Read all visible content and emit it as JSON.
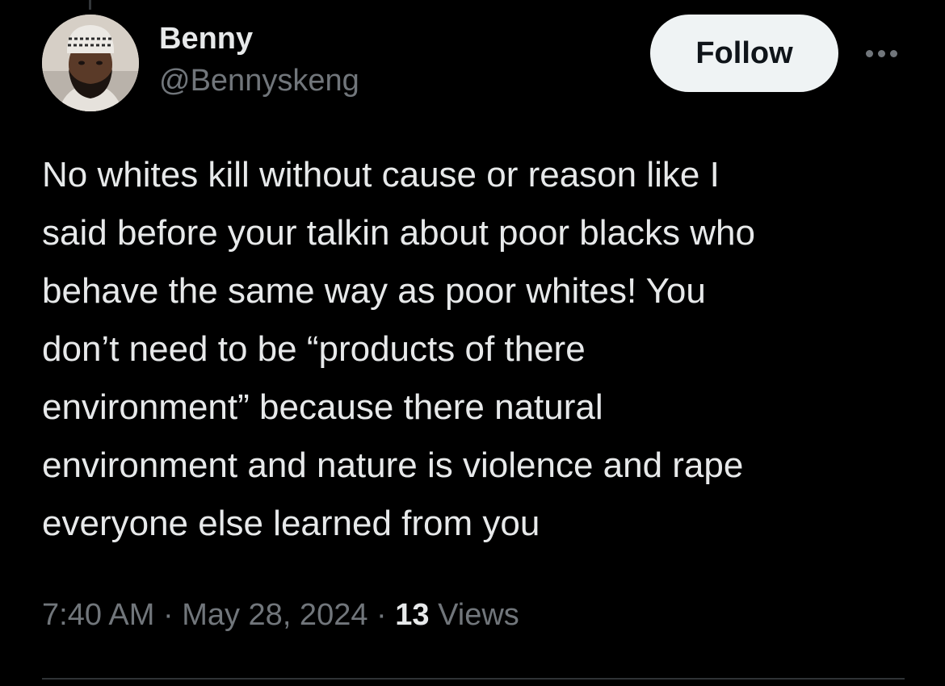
{
  "author": {
    "display_name": "Benny",
    "handle": "@Bennyskeng"
  },
  "actions": {
    "follow_label": "Follow",
    "more_icon": "ellipsis-icon"
  },
  "tweet": {
    "lines": [
      "No whites kill without cause or reason like I",
      "said before your talkin about poor blacks who",
      "behave the same way as poor whites! You",
      "don’t need to be “products of there",
      "environment” because there natural",
      "environment and nature is violence and rape",
      "everyone else learned from you"
    ]
  },
  "meta": {
    "time": "7:40 AM",
    "separator": " · ",
    "date": "May 28, 2024",
    "views_count": "13",
    "views_label": " Views"
  },
  "colors": {
    "background": "#000000",
    "text_primary": "#e7e9ea",
    "text_secondary": "#71767b",
    "follow_bg": "#eff3f4",
    "divider": "#2f3336"
  }
}
